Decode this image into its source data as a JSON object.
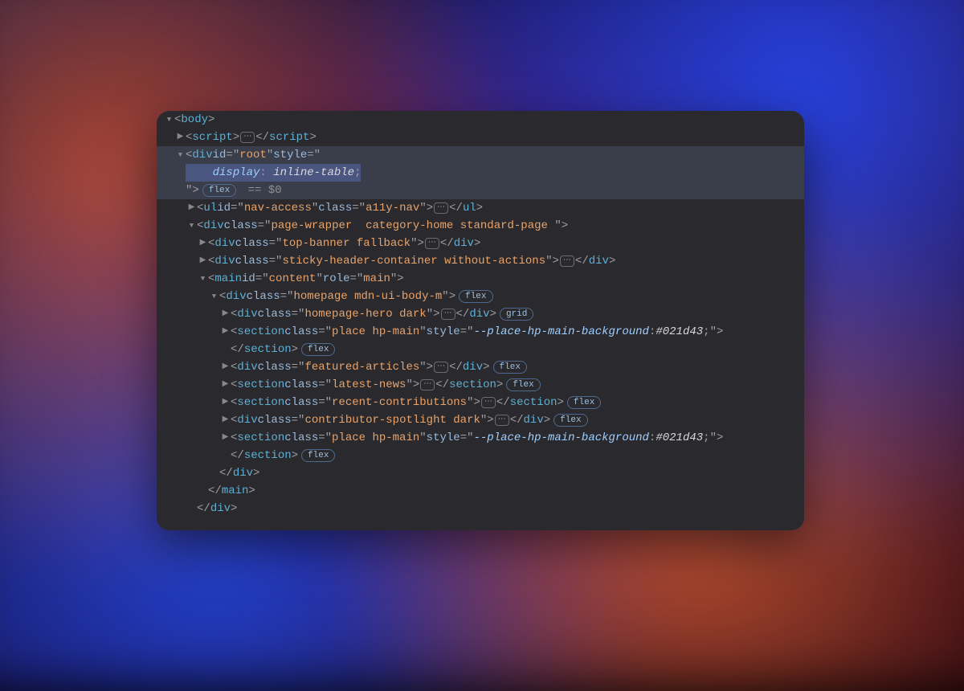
{
  "badges": {
    "flex": "flex",
    "grid": "grid"
  },
  "eq0": " == $0",
  "ellipsis": "⋯",
  "lines": [
    {
      "indent": 0,
      "arrow": "down",
      "parts": [
        {
          "t": "pun",
          "v": "<"
        },
        {
          "t": "tag",
          "v": "body"
        },
        {
          "t": "pun",
          "v": ">"
        }
      ]
    },
    {
      "indent": 1,
      "arrow": "right",
      "parts": [
        {
          "t": "pun",
          "v": "<"
        },
        {
          "t": "tag",
          "v": "script"
        },
        {
          "t": "pun",
          "v": ">"
        },
        {
          "t": "ell"
        },
        {
          "t": "pun",
          "v": "</"
        },
        {
          "t": "tag",
          "v": "script"
        },
        {
          "t": "pun",
          "v": ">"
        }
      ]
    },
    {
      "indent": 1,
      "arrow": "down",
      "sel": true,
      "parts": [
        {
          "t": "pun",
          "v": "<"
        },
        {
          "t": "tag",
          "v": "div"
        },
        {
          "t": "sp"
        },
        {
          "t": "attr",
          "v": "id"
        },
        {
          "t": "pun",
          "v": "=\""
        },
        {
          "t": "str",
          "v": "root"
        },
        {
          "t": "pun",
          "v": "\""
        },
        {
          "t": "sp"
        },
        {
          "t": "sp"
        },
        {
          "t": "attr",
          "v": "style"
        },
        {
          "t": "pun",
          "v": "=\""
        }
      ]
    },
    {
      "indent": 1,
      "arrow": "none",
      "sel": true,
      "parts": [
        {
          "t": "selstart"
        },
        {
          "t": "raw",
          "v": "    "
        },
        {
          "t": "key",
          "v": "display"
        },
        {
          "t": "pun",
          "v": ":"
        },
        {
          "t": "sp"
        },
        {
          "t": "val",
          "v": "inline-table"
        },
        {
          "t": "pun",
          "v": ";"
        },
        {
          "t": "selend"
        }
      ]
    },
    {
      "indent": 1,
      "arrow": "none",
      "sel": true,
      "parts": [
        {
          "t": "pun",
          "v": "\">"
        },
        {
          "t": "sp"
        },
        {
          "t": "badge",
          "v": "flex"
        },
        {
          "t": "eq0"
        }
      ]
    },
    {
      "indent": 2,
      "arrow": "right",
      "parts": [
        {
          "t": "pun",
          "v": "<"
        },
        {
          "t": "tag",
          "v": "ul"
        },
        {
          "t": "sp"
        },
        {
          "t": "attr",
          "v": "id"
        },
        {
          "t": "pun",
          "v": "=\""
        },
        {
          "t": "str",
          "v": "nav-access"
        },
        {
          "t": "pun",
          "v": "\""
        },
        {
          "t": "sp"
        },
        {
          "t": "attr",
          "v": "class"
        },
        {
          "t": "pun",
          "v": "=\""
        },
        {
          "t": "str",
          "v": "a11y-nav"
        },
        {
          "t": "pun",
          "v": "\">"
        },
        {
          "t": "ell"
        },
        {
          "t": "pun",
          "v": "</"
        },
        {
          "t": "tag",
          "v": "ul"
        },
        {
          "t": "pun",
          "v": ">"
        }
      ]
    },
    {
      "indent": 2,
      "arrow": "down",
      "parts": [
        {
          "t": "pun",
          "v": "<"
        },
        {
          "t": "tag",
          "v": "div"
        },
        {
          "t": "sp"
        },
        {
          "t": "attr",
          "v": "class"
        },
        {
          "t": "pun",
          "v": "=\""
        },
        {
          "t": "str",
          "v": "page-wrapper  category-home standard-page "
        },
        {
          "t": "pun",
          "v": "\">"
        }
      ]
    },
    {
      "indent": 3,
      "arrow": "right",
      "parts": [
        {
          "t": "pun",
          "v": "<"
        },
        {
          "t": "tag",
          "v": "div"
        },
        {
          "t": "sp"
        },
        {
          "t": "attr",
          "v": "class"
        },
        {
          "t": "pun",
          "v": "=\""
        },
        {
          "t": "str",
          "v": "top-banner fallback"
        },
        {
          "t": "pun",
          "v": "\">"
        },
        {
          "t": "ell"
        },
        {
          "t": "pun",
          "v": "</"
        },
        {
          "t": "tag",
          "v": "div"
        },
        {
          "t": "pun",
          "v": ">"
        }
      ]
    },
    {
      "indent": 3,
      "arrow": "right",
      "parts": [
        {
          "t": "pun",
          "v": "<"
        },
        {
          "t": "tag",
          "v": "div"
        },
        {
          "t": "sp"
        },
        {
          "t": "attr",
          "v": "class"
        },
        {
          "t": "pun",
          "v": "=\""
        },
        {
          "t": "str",
          "v": "sticky-header-container without-actions"
        },
        {
          "t": "pun",
          "v": "\">"
        },
        {
          "t": "ell"
        },
        {
          "t": "pun",
          "v": "</"
        },
        {
          "t": "tag",
          "v": "div"
        },
        {
          "t": "pun",
          "v": ">"
        }
      ]
    },
    {
      "indent": 3,
      "arrow": "down",
      "parts": [
        {
          "t": "pun",
          "v": "<"
        },
        {
          "t": "tag",
          "v": "main"
        },
        {
          "t": "sp"
        },
        {
          "t": "attr",
          "v": "id"
        },
        {
          "t": "pun",
          "v": "=\""
        },
        {
          "t": "str",
          "v": "content"
        },
        {
          "t": "pun",
          "v": "\""
        },
        {
          "t": "sp"
        },
        {
          "t": "attr",
          "v": "role"
        },
        {
          "t": "pun",
          "v": "=\""
        },
        {
          "t": "str",
          "v": "main"
        },
        {
          "t": "pun",
          "v": "\">"
        }
      ]
    },
    {
      "indent": 4,
      "arrow": "down",
      "parts": [
        {
          "t": "pun",
          "v": "<"
        },
        {
          "t": "tag",
          "v": "div"
        },
        {
          "t": "sp"
        },
        {
          "t": "attr",
          "v": "class"
        },
        {
          "t": "pun",
          "v": "=\""
        },
        {
          "t": "str",
          "v": "homepage mdn-ui-body-m"
        },
        {
          "t": "pun",
          "v": "\">"
        },
        {
          "t": "sp"
        },
        {
          "t": "badge",
          "v": "flex"
        }
      ]
    },
    {
      "indent": 5,
      "arrow": "right",
      "parts": [
        {
          "t": "pun",
          "v": "<"
        },
        {
          "t": "tag",
          "v": "div"
        },
        {
          "t": "sp"
        },
        {
          "t": "attr",
          "v": "class"
        },
        {
          "t": "pun",
          "v": "=\""
        },
        {
          "t": "str",
          "v": "homepage-hero dark"
        },
        {
          "t": "pun",
          "v": "\">"
        },
        {
          "t": "ell"
        },
        {
          "t": "pun",
          "v": "</"
        },
        {
          "t": "tag",
          "v": "div"
        },
        {
          "t": "pun",
          "v": ">"
        },
        {
          "t": "sp"
        },
        {
          "t": "badge",
          "v": "grid"
        }
      ]
    },
    {
      "indent": 5,
      "arrow": "right",
      "parts": [
        {
          "t": "pun",
          "v": "<"
        },
        {
          "t": "tag",
          "v": "section"
        },
        {
          "t": "sp"
        },
        {
          "t": "attr",
          "v": "class"
        },
        {
          "t": "pun",
          "v": "=\""
        },
        {
          "t": "str",
          "v": "place hp-main"
        },
        {
          "t": "pun",
          "v": "\""
        },
        {
          "t": "sp"
        },
        {
          "t": "attr",
          "v": "style"
        },
        {
          "t": "pun",
          "v": "=\""
        },
        {
          "t": "key",
          "v": "--place-hp-main-background"
        },
        {
          "t": "pun",
          "v": ":"
        },
        {
          "t": "sp"
        },
        {
          "t": "val",
          "v": "#021d43"
        },
        {
          "t": "pun",
          "v": ";"
        },
        {
          "t": "pun",
          "v": "\">"
        }
      ]
    },
    {
      "indent": 5,
      "arrow": "none",
      "parts": [
        {
          "t": "raw",
          "v": " "
        },
        {
          "t": "pun",
          "v": "</"
        },
        {
          "t": "tag",
          "v": "section"
        },
        {
          "t": "pun",
          "v": ">"
        },
        {
          "t": "sp"
        },
        {
          "t": "badge",
          "v": "flex"
        }
      ]
    },
    {
      "indent": 5,
      "arrow": "right",
      "parts": [
        {
          "t": "pun",
          "v": "<"
        },
        {
          "t": "tag",
          "v": "div"
        },
        {
          "t": "sp"
        },
        {
          "t": "attr",
          "v": "class"
        },
        {
          "t": "pun",
          "v": "=\""
        },
        {
          "t": "str",
          "v": "featured-articles"
        },
        {
          "t": "pun",
          "v": "\">"
        },
        {
          "t": "ell"
        },
        {
          "t": "pun",
          "v": "</"
        },
        {
          "t": "tag",
          "v": "div"
        },
        {
          "t": "pun",
          "v": ">"
        },
        {
          "t": "sp"
        },
        {
          "t": "badge",
          "v": "flex"
        }
      ]
    },
    {
      "indent": 5,
      "arrow": "right",
      "parts": [
        {
          "t": "pun",
          "v": "<"
        },
        {
          "t": "tag",
          "v": "section"
        },
        {
          "t": "sp"
        },
        {
          "t": "attr",
          "v": "class"
        },
        {
          "t": "pun",
          "v": "=\""
        },
        {
          "t": "str",
          "v": "latest-news"
        },
        {
          "t": "pun",
          "v": "\">"
        },
        {
          "t": "ell"
        },
        {
          "t": "pun",
          "v": "</"
        },
        {
          "t": "tag",
          "v": "section"
        },
        {
          "t": "pun",
          "v": ">"
        },
        {
          "t": "sp"
        },
        {
          "t": "badge",
          "v": "flex"
        }
      ]
    },
    {
      "indent": 5,
      "arrow": "right",
      "parts": [
        {
          "t": "pun",
          "v": "<"
        },
        {
          "t": "tag",
          "v": "section"
        },
        {
          "t": "sp"
        },
        {
          "t": "attr",
          "v": "class"
        },
        {
          "t": "pun",
          "v": "=\""
        },
        {
          "t": "str",
          "v": "recent-contributions"
        },
        {
          "t": "pun",
          "v": "\">"
        },
        {
          "t": "ell"
        },
        {
          "t": "pun",
          "v": "</"
        },
        {
          "t": "tag",
          "v": "section"
        },
        {
          "t": "pun",
          "v": ">"
        },
        {
          "t": "sp"
        },
        {
          "t": "badge",
          "v": "flex"
        }
      ]
    },
    {
      "indent": 5,
      "arrow": "right",
      "parts": [
        {
          "t": "pun",
          "v": "<"
        },
        {
          "t": "tag",
          "v": "div"
        },
        {
          "t": "sp"
        },
        {
          "t": "attr",
          "v": "class"
        },
        {
          "t": "pun",
          "v": "=\""
        },
        {
          "t": "str",
          "v": "contributor-spotlight dark"
        },
        {
          "t": "pun",
          "v": "\">"
        },
        {
          "t": "ell"
        },
        {
          "t": "pun",
          "v": "</"
        },
        {
          "t": "tag",
          "v": "div"
        },
        {
          "t": "pun",
          "v": ">"
        },
        {
          "t": "sp"
        },
        {
          "t": "badge",
          "v": "flex"
        }
      ]
    },
    {
      "indent": 5,
      "arrow": "right",
      "parts": [
        {
          "t": "pun",
          "v": "<"
        },
        {
          "t": "tag",
          "v": "section"
        },
        {
          "t": "sp"
        },
        {
          "t": "attr",
          "v": "class"
        },
        {
          "t": "pun",
          "v": "=\""
        },
        {
          "t": "str",
          "v": "place hp-main"
        },
        {
          "t": "pun",
          "v": "\""
        },
        {
          "t": "sp"
        },
        {
          "t": "attr",
          "v": "style"
        },
        {
          "t": "pun",
          "v": "=\""
        },
        {
          "t": "key",
          "v": "--place-hp-main-background"
        },
        {
          "t": "pun",
          "v": ":"
        },
        {
          "t": "sp"
        },
        {
          "t": "val",
          "v": "#021d43"
        },
        {
          "t": "pun",
          "v": ";"
        },
        {
          "t": "pun",
          "v": "\">"
        }
      ]
    },
    {
      "indent": 5,
      "arrow": "none",
      "parts": [
        {
          "t": "raw",
          "v": " "
        },
        {
          "t": "pun",
          "v": "</"
        },
        {
          "t": "tag",
          "v": "section"
        },
        {
          "t": "pun",
          "v": ">"
        },
        {
          "t": "sp"
        },
        {
          "t": "badge",
          "v": "flex"
        }
      ]
    },
    {
      "indent": 4,
      "arrow": "none",
      "parts": [
        {
          "t": "raw",
          "v": " "
        },
        {
          "t": "pun",
          "v": "</"
        },
        {
          "t": "tag",
          "v": "div"
        },
        {
          "t": "pun",
          "v": ">"
        }
      ]
    },
    {
      "indent": 3,
      "arrow": "none",
      "parts": [
        {
          "t": "raw",
          "v": " "
        },
        {
          "t": "pun",
          "v": "</"
        },
        {
          "t": "tag",
          "v": "main"
        },
        {
          "t": "pun",
          "v": ">"
        }
      ]
    },
    {
      "indent": 2,
      "arrow": "none",
      "parts": [
        {
          "t": "raw",
          "v": " "
        },
        {
          "t": "pun",
          "v": "</"
        },
        {
          "t": "tag",
          "v": "div"
        },
        {
          "t": "pun",
          "v": ">"
        }
      ]
    }
  ]
}
